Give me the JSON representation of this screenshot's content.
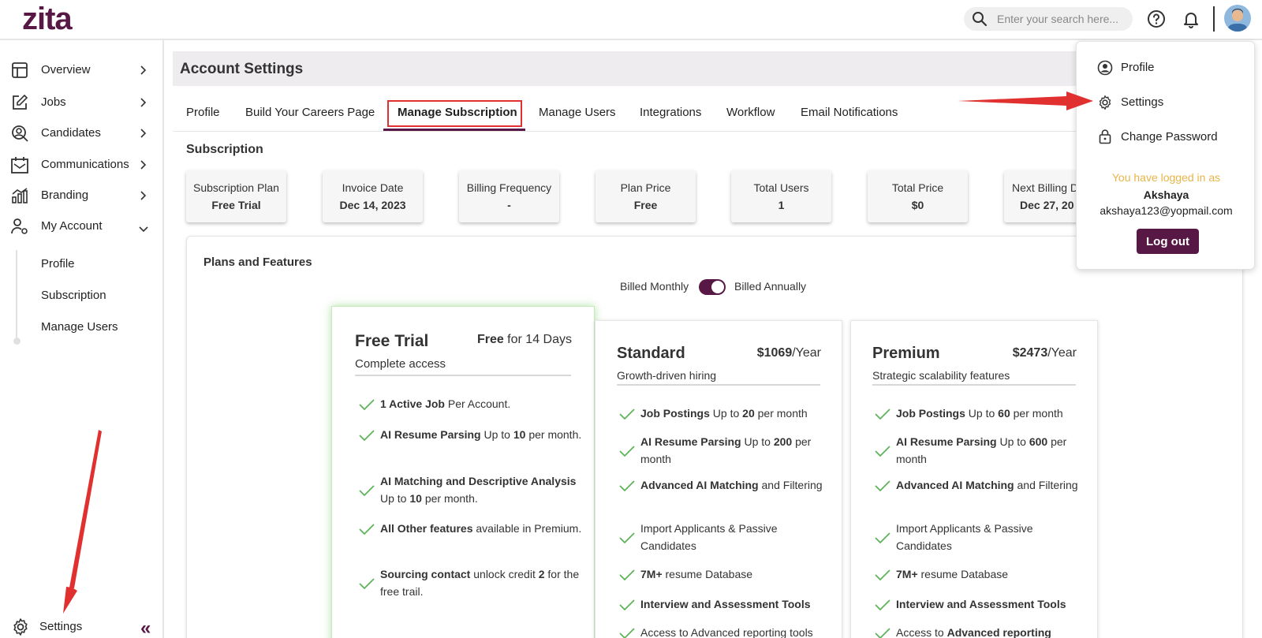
{
  "brand": {
    "logo": "zita",
    "primary": "#581845",
    "annotation_red": "#e03030"
  },
  "header": {
    "search_placeholder": "Enter your search here..."
  },
  "sidebar": {
    "items": [
      {
        "label": "Overview",
        "icon": "layout-icon"
      },
      {
        "label": "Jobs",
        "icon": "edit-icon"
      },
      {
        "label": "Candidates",
        "icon": "user-search-icon"
      },
      {
        "label": "Communications",
        "icon": "calendar-mail-icon"
      },
      {
        "label": "Branding",
        "icon": "chart-icon"
      },
      {
        "label": "My Account",
        "icon": "user-gear-icon"
      }
    ],
    "sub_items": [
      "Profile",
      "Subscription",
      "Manage Users"
    ],
    "settings_label": "Settings",
    "collapse_glyph": "«"
  },
  "page": {
    "title": "Account Settings",
    "tabs": [
      "Profile",
      "Build Your Careers Page",
      "Manage Subscription",
      "Manage Users",
      "Integrations",
      "Workflow",
      "Email Notifications"
    ],
    "active_tab": "Manage Subscription"
  },
  "subscription": {
    "title": "Subscription",
    "stats": [
      {
        "label": "Subscription Plan",
        "value": "Free Trial"
      },
      {
        "label": "Invoice Date",
        "value": "Dec 14, 2023"
      },
      {
        "label": "Billing Frequency",
        "value": "-"
      },
      {
        "label": "Plan Price",
        "value": "Free"
      },
      {
        "label": "Total Users",
        "value": "1"
      },
      {
        "label": "Total Price",
        "value": "$0"
      },
      {
        "label": "Next Billing D",
        "value": "Dec 27, 20"
      }
    ]
  },
  "plans": {
    "title": "Plans and Features",
    "billed_monthly": "Billed Monthly",
    "billed_annually": "Billed Annually",
    "free": {
      "name": "Free Trial",
      "price_bold": "Free",
      "price_rest": " for 14 Days",
      "subtitle": "Complete access",
      "features": [
        {
          "bold": "1 Active Job",
          "rest": " Per Account."
        },
        {
          "bold": "AI Resume Parsing",
          "rest": " Up to ",
          "bold2": "10",
          "rest2": " per month."
        },
        {
          "bold": "AI Matching and Descriptive Analysis",
          "rest": " Up to ",
          "bold2": "10",
          "rest2": " per month."
        },
        {
          "bold": "All Other features",
          "rest": " available in Premium."
        },
        {
          "bold": "Sourcing contact",
          "rest": " unlock credit ",
          "bold2": "2",
          "rest2": " for the free trail."
        }
      ]
    },
    "standard": {
      "name": "Standard",
      "price_bold": "$1069",
      "price_rest": "/Year",
      "subtitle": "Growth-driven hiring",
      "features": [
        {
          "bold": "Job Postings",
          "rest": " Up to ",
          "bold2": "20",
          "rest2": " per month"
        },
        {
          "bold": "AI Resume Parsing",
          "rest": " Up to ",
          "bold2": "200",
          "rest2": " per month"
        },
        {
          "bold": "Advanced AI Matching",
          "rest": " and Filtering"
        },
        {
          "bold": "",
          "rest": "Import Applicants & Passive Candidates"
        },
        {
          "bold": "7M+",
          "rest": " resume Database"
        },
        {
          "bold": "Interview and Assessment Tools",
          "rest": ""
        },
        {
          "bold": "",
          "rest": "Access to Advanced reporting tools"
        }
      ]
    },
    "premium": {
      "name": "Premium",
      "price_bold": "$2473",
      "price_rest": "/Year",
      "subtitle": "Strategic scalability features",
      "features": [
        {
          "bold": "Job Postings",
          "rest": " Up to ",
          "bold2": "60",
          "rest2": " per month"
        },
        {
          "bold": "AI Resume Parsing",
          "rest": " Up to ",
          "bold2": "600",
          "rest2": " per month"
        },
        {
          "bold": "Advanced AI Matching",
          "rest": " and Filtering"
        },
        {
          "bold": "",
          "rest": "Import Applicants & Passive Candidates"
        },
        {
          "bold": "7M+",
          "rest": " resume Database"
        },
        {
          "bold": "Interview and Assessment Tools",
          "rest": ""
        },
        {
          "bold": "",
          "rest": "Access to ",
          "bold2": "Advanced reporting",
          "rest2": ""
        }
      ]
    }
  },
  "profile_menu": {
    "items": [
      {
        "label": "Profile",
        "icon": "user-circle-icon"
      },
      {
        "label": "Settings",
        "icon": "gear-icon"
      },
      {
        "label": "Change Password",
        "icon": "lock-icon"
      }
    ],
    "logged_in_text": "You have logged in as",
    "user_name": "Akshaya",
    "user_email": "akshaya123@yopmail.com",
    "logout_label": "Log out"
  }
}
